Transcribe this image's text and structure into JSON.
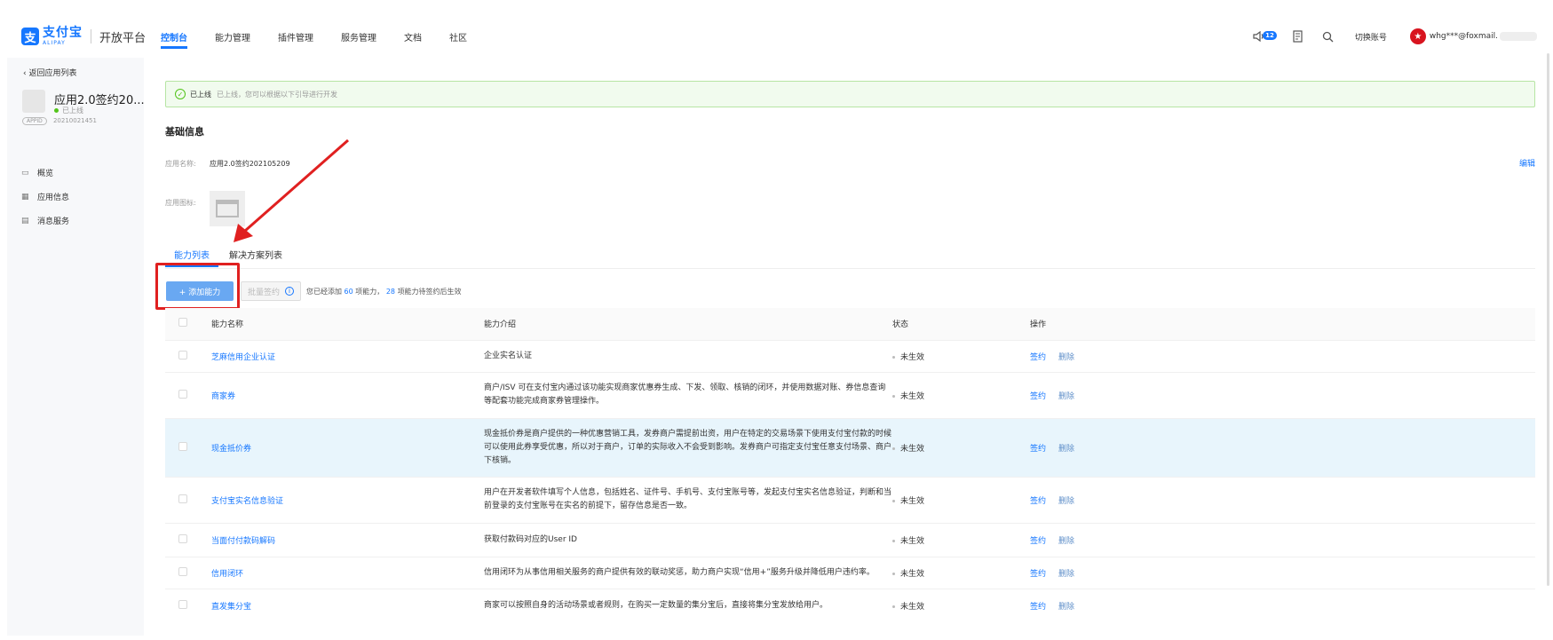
{
  "header": {
    "logo_mark": "支",
    "logo_cn": "支付宝",
    "logo_en": "ALIPAY",
    "product": "开放平台",
    "nav": [
      "控制台",
      "能力管理",
      "插件管理",
      "服务管理",
      "文档",
      "社区"
    ],
    "notification_count": "12",
    "switch_account": "切换账号",
    "user_email": "whg***@foxmail.",
    "accent": "#1677ff"
  },
  "sidebar": {
    "back": "返回应用列表",
    "app_name": "应用2.0签约20...",
    "app_status": "已上线",
    "appid_tag": "APPID",
    "app_id": "20210021451",
    "items": [
      {
        "icon": "overview-icon",
        "label": "概览"
      },
      {
        "icon": "app-info-icon",
        "label": "应用信息"
      },
      {
        "icon": "message-icon",
        "label": "消息服务"
      }
    ]
  },
  "main": {
    "alert_title": "已上线",
    "alert_text": "已上线，您可以根据以下引导进行开发",
    "section_title": "基础信息",
    "name_label": "应用名称:",
    "name_value": "应用2.0签约202105209",
    "edit": "编辑",
    "icon_label": "应用图标:",
    "tabs": [
      "能力列表",
      "解决方案列表"
    ],
    "add_button": "+ 添加能力",
    "batch_button": "批量签约",
    "summary_prefix": "您已经添加",
    "summary_added": "60",
    "summary_mid": "项能力，",
    "summary_pending": "28",
    "summary_suffix": "项能力待签约后生效"
  },
  "table": {
    "headers": [
      "能力名称",
      "能力介绍",
      "状态",
      "操作"
    ],
    "sign": "签约",
    "delete": "删除",
    "rows": [
      {
        "name": "芝麻信用企业认证",
        "desc": "企业实名认证",
        "state": "未生效"
      },
      {
        "name": "商家券",
        "desc": "商户/ISV 可在支付宝内通过该功能实现商家优惠券生成、下发、领取、核销的闭环，并使用数据对账、券信息查询等配套功能完成商家券管理操作。",
        "state": "未生效"
      },
      {
        "name": "现金抵价券",
        "desc": "现金抵价券是商户提供的一种优惠营销工具，发券商户需提前出资，用户在特定的交易场景下使用支付宝付款的时候可以使用此券享受优惠，所以对于商户，订单的实际收入不会受到影响。发券商户可指定支付宝任意支付场景、商户下核销。",
        "state": "未生效"
      },
      {
        "name": "支付宝实名信息验证",
        "desc": "用户在开发者软件填写个人信息，包括姓名、证件号、手机号、支付宝账号等，发起支付宝实名信息验证，判断和当前登录的支付宝账号在实名的前提下，留存信息是否一致。",
        "state": "未生效"
      },
      {
        "name": "当面付付款码解码",
        "desc": "获取付款码对应的User ID",
        "state": "未生效"
      },
      {
        "name": "信用闭环",
        "desc": "信用闭环为从事信用相关服务的商户提供有效的联动奖惩，助力商户实现“信用+”服务升级并降低用户违约率。",
        "state": "未生效"
      },
      {
        "name": "直发集分宝",
        "desc": "商家可以按照自身的活动场景或者规则，在购买一定数量的集分宝后，直接将集分宝发放给用户。",
        "state": "未生效"
      }
    ]
  }
}
